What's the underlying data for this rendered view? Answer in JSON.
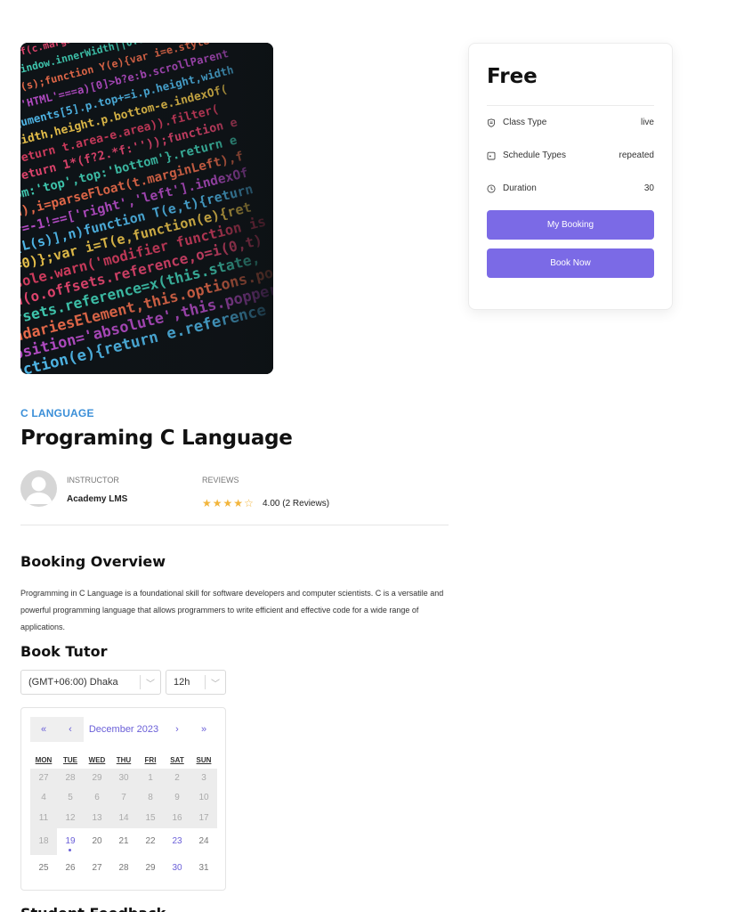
{
  "course": {
    "category": "C LANGUAGE",
    "title": "Programing C Language",
    "image_icon": "code-screen-image"
  },
  "sidebar_card": {
    "price": "Free",
    "rows": [
      {
        "icon": "shield-icon",
        "label": "Class Type",
        "value": "live"
      },
      {
        "icon": "calendar-icon",
        "label": "Schedule Types",
        "value": "repeated"
      },
      {
        "icon": "clock-icon",
        "label": "Duration",
        "value": "30"
      }
    ],
    "my_booking_label": "My Booking",
    "book_now_label": "Book Now",
    "accent_color": "#7b6ae6"
  },
  "instructor": {
    "label": "INSTRUCTOR",
    "name": "Academy LMS"
  },
  "reviews": {
    "label": "REVIEWS",
    "rating": 4.0,
    "stars_filled": 4,
    "stars_total": 5,
    "text": "4.00 (2 Reviews)"
  },
  "booking_overview": {
    "heading": "Booking Overview",
    "description": "Programming in C Language is a foundational skill for software developers and computer scientists. C is a versatile and powerful programming language that allows programmers to write efficient and effective code for a wide range of applications."
  },
  "book_tutor": {
    "heading": "Book Tutor",
    "timezone": "(GMT+06:00) Dhaka",
    "time_format": "12h"
  },
  "calendar": {
    "prev_year": "«",
    "prev_month": "‹",
    "month_label": "December 2023",
    "next_month": "›",
    "next_year": "»",
    "weekdays": [
      "MON",
      "TUE",
      "WED",
      "THU",
      "FRI",
      "SAT",
      "SUN"
    ],
    "weeks": [
      [
        "27",
        "28",
        "29",
        "30",
        "1",
        "2",
        "3"
      ],
      [
        "4",
        "5",
        "6",
        "7",
        "8",
        "9",
        "10"
      ],
      [
        "11",
        "12",
        "13",
        "14",
        "15",
        "16",
        "17"
      ],
      [
        "18",
        "19",
        "20",
        "21",
        "22",
        "23",
        "24"
      ],
      [
        "25",
        "26",
        "27",
        "28",
        "29",
        "30",
        "31"
      ]
    ],
    "today": "19",
    "highlighted": [
      "23",
      "30"
    ]
  },
  "footer": {
    "heading": "Student Feedback"
  }
}
